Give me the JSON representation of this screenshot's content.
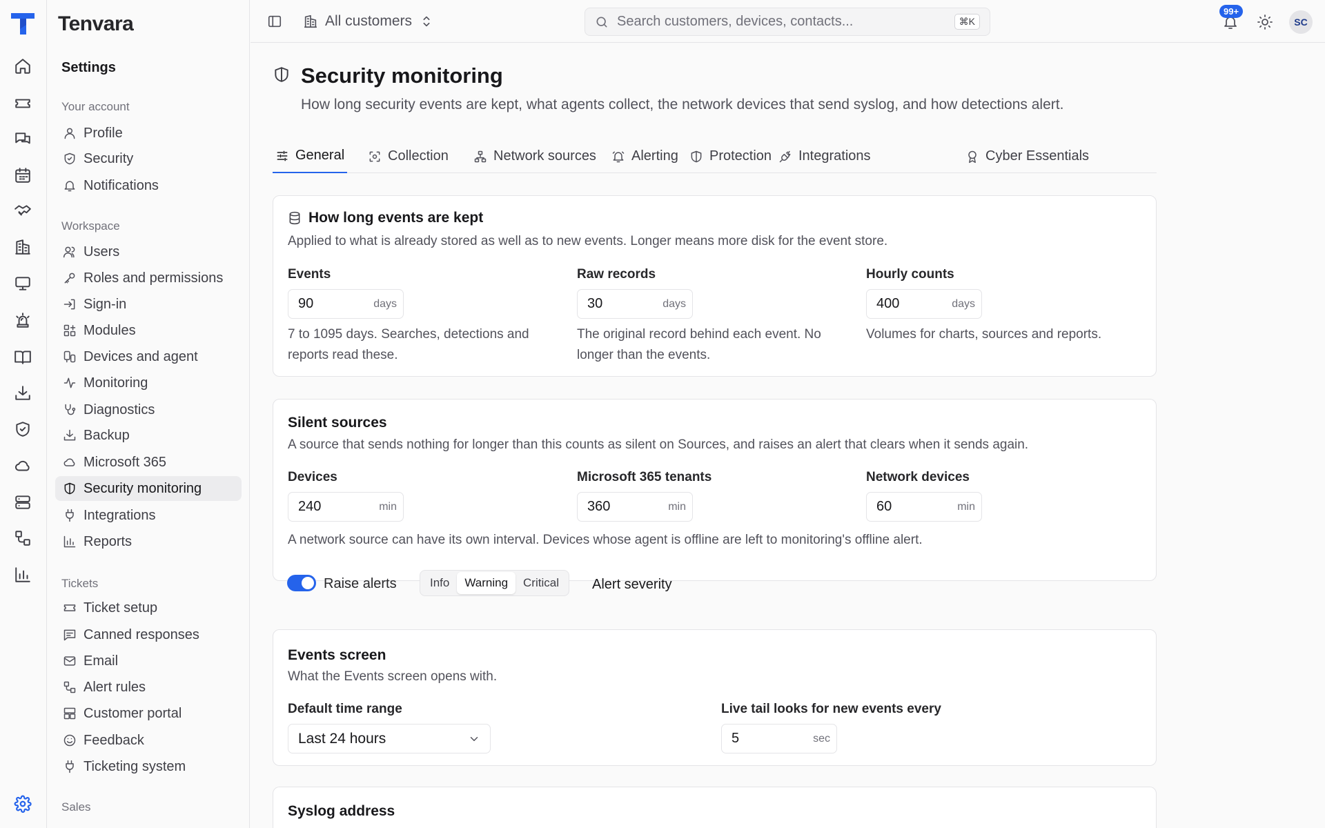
{
  "brand": "Tenvara",
  "settings_title": "Settings",
  "groups": {
    "account": "Your account",
    "workspace": "Workspace",
    "tickets": "Tickets",
    "sales": "Sales"
  },
  "nav": {
    "profile": "Profile",
    "security": "Security",
    "notifications": "Notifications",
    "users": "Users",
    "roles": "Roles and permissions",
    "signin": "Sign-in",
    "modules": "Modules",
    "devices": "Devices and agent",
    "monitoring": "Monitoring",
    "diagnostics": "Diagnostics",
    "backup": "Backup",
    "m365": "Microsoft 365",
    "secmon": "Security monitoring",
    "integrations": "Integrations",
    "reports": "Reports",
    "ticket_setup": "Ticket setup",
    "canned": "Canned responses",
    "email": "Email",
    "alert_rules": "Alert rules",
    "portal": "Customer portal",
    "feedback": "Feedback",
    "ticketing": "Ticketing system"
  },
  "topbar": {
    "customer": "All customers",
    "search_placeholder": "Search customers, devices, contacts...",
    "shortcut": "⌘K",
    "notif_badge": "99+",
    "avatar": "SC"
  },
  "page": {
    "title": "Security monitoring",
    "subtitle": "How long security events are kept, what agents collect, the network devices that send syslog, and how detections alert."
  },
  "tabs": {
    "general": "General",
    "collection": "Collection",
    "network": "Network sources",
    "alerting": "Alerting",
    "protection": "Protection",
    "integrations": "Integrations",
    "cyber": "Cyber Essentials"
  },
  "retention": {
    "title": "How long events are kept",
    "desc": "Applied to what is already stored as well as to new events. Longer means more disk for the event store.",
    "events_label": "Events",
    "events_value": "90",
    "raw_label": "Raw records",
    "raw_value": "30",
    "hourly_label": "Hourly counts",
    "hourly_value": "400",
    "unit": "days",
    "events_help_1": "7 to 1095 days. Searches, detections and",
    "events_help_2": "reports read these.",
    "raw_help_1": "The original record behind each event. No",
    "raw_help_2": "longer than the events.",
    "hourly_help": "Volumes for charts, sources and reports."
  },
  "silent": {
    "title": "Silent sources",
    "desc": "A source that sends nothing for longer than this counts as silent on Sources, and raises an alert that clears when it sends again.",
    "devices_label": "Devices",
    "devices_value": "240",
    "m365_label": "Microsoft 365 tenants",
    "m365_value": "360",
    "net_label": "Network devices",
    "net_value": "60",
    "unit": "min",
    "note": "A network source can have its own interval. Devices whose agent is offline are left to monitoring's offline alert.",
    "raise_alerts": "Raise alerts",
    "severity_options": [
      "Info",
      "Warning",
      "Critical"
    ],
    "severity_selected": "Warning",
    "severity_label": "Alert severity"
  },
  "events_screen": {
    "title": "Events screen",
    "desc": "What the Events screen opens with.",
    "range_label": "Default time range",
    "range_value": "Last 24 hours",
    "tail_label": "Live tail looks for new events every",
    "tail_value": "5",
    "tail_unit": "sec"
  },
  "syslog": {
    "title": "Syslog address"
  },
  "colors": {
    "accent": "#2563eb",
    "border": "#e4e4e7",
    "background": "#fafafa"
  }
}
